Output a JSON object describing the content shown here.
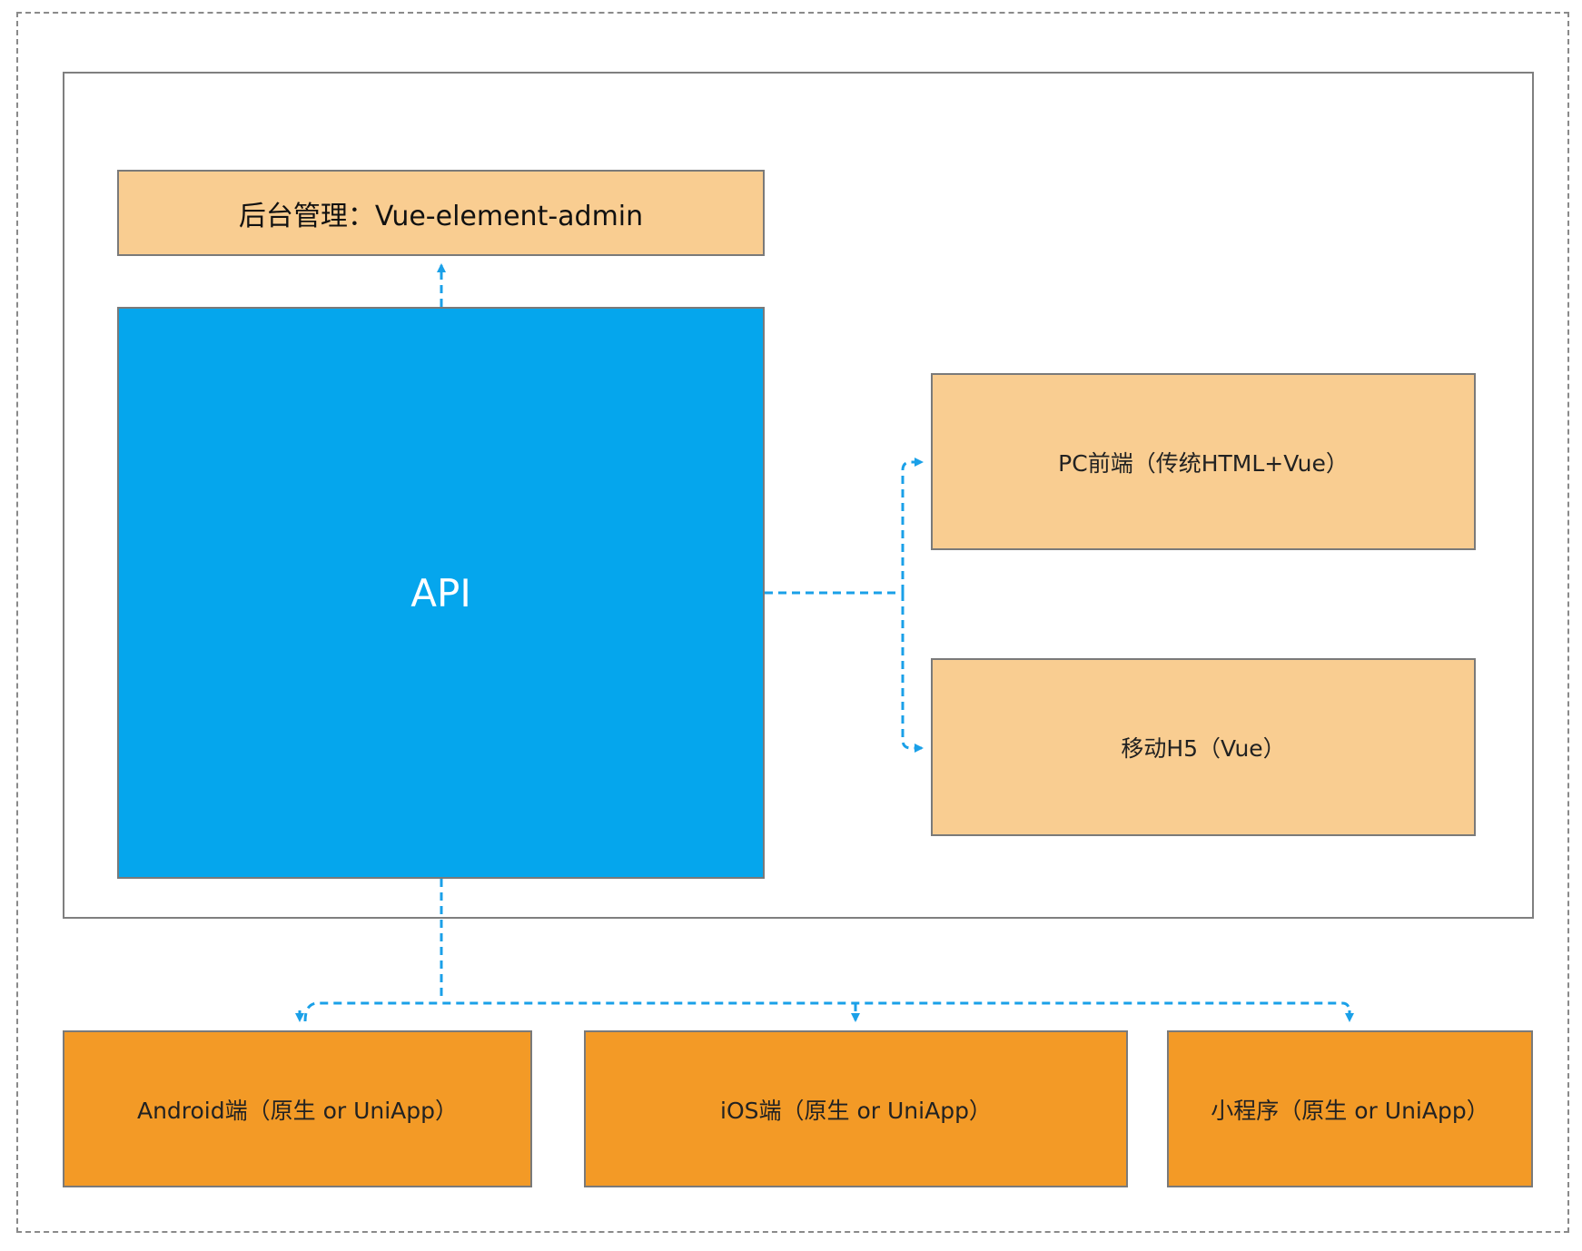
{
  "diagram": {
    "nodes": {
      "admin": "后台管理：Vue-element-admin",
      "api": "API",
      "pc": "PC前端（传统HTML+Vue）",
      "h5": "移动H5（Vue）",
      "android": "Android端（原生 or UniApp）",
      "ios": "iOS端（原生 or UniApp）",
      "mini": "小程序（原生 or UniApp）"
    },
    "edges": [
      {
        "from": "api",
        "to": "admin"
      },
      {
        "from": "api",
        "to": "pc"
      },
      {
        "from": "api",
        "to": "h5"
      },
      {
        "from": "api",
        "to": "android"
      },
      {
        "from": "api",
        "to": "ios"
      },
      {
        "from": "api",
        "to": "mini"
      }
    ],
    "colors": {
      "api_fill": "#05a6ed",
      "client_light_fill": "#f9cd91",
      "client_dark_fill": "#f39a26",
      "connector": "#1aa0e8",
      "border": "#7a7a7a"
    }
  }
}
